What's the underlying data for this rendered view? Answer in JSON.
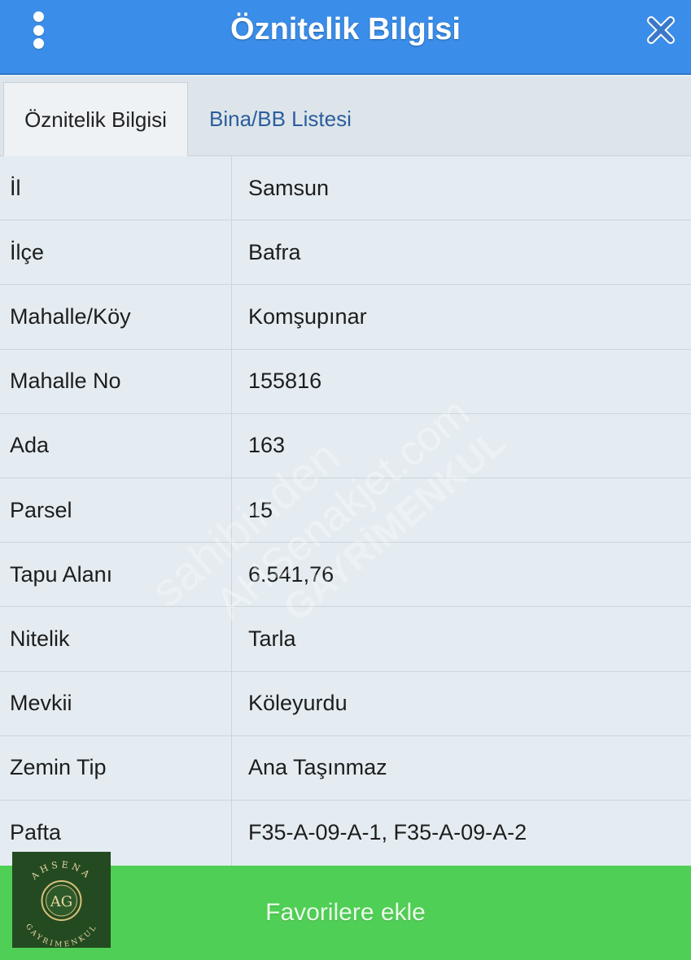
{
  "header": {
    "title": "Öznitelik Bilgisi",
    "menu_icon": "vertical-dots-icon",
    "close_icon": "close-icon"
  },
  "tabs": [
    {
      "label": "Öznitelik Bilgisi",
      "active": true
    },
    {
      "label": "Bina/BB Listesi",
      "active": false
    }
  ],
  "rows": [
    {
      "label": "İl",
      "value": "Samsun"
    },
    {
      "label": "İlçe",
      "value": "Bafra"
    },
    {
      "label": "Mahalle/Köy",
      "value": "Komşupınar"
    },
    {
      "label": "Mahalle No",
      "value": "155816"
    },
    {
      "label": "Ada",
      "value": "163"
    },
    {
      "label": "Parsel",
      "value": "15"
    },
    {
      "label": "Tapu Alanı",
      "value": "6.541,76"
    },
    {
      "label": "Nitelik",
      "value": "Tarla"
    },
    {
      "label": "Mevkii",
      "value": "Köleyurdu"
    },
    {
      "label": "Zemin Tip",
      "value": "Ana Taşınmaz"
    },
    {
      "label": "Pafta",
      "value": "F35-A-09-A-1, F35-A-09-A-2"
    }
  ],
  "footer": {
    "button_label": "Favorilere ekle"
  },
  "watermark": {
    "line1": "sahibinden",
    "line2": "AHSenakjet.com",
    "line3": "GAYRİMENKUL"
  },
  "logo": {
    "top_text": "AHSENA",
    "monogram": "AG",
    "bottom_text": "GAYRIMENKUL"
  },
  "colors": {
    "header_bg": "#3a8ee9",
    "footer_bg": "#4fcf55",
    "table_bg": "#e4ecf1",
    "close_x": "#3b78c9"
  }
}
